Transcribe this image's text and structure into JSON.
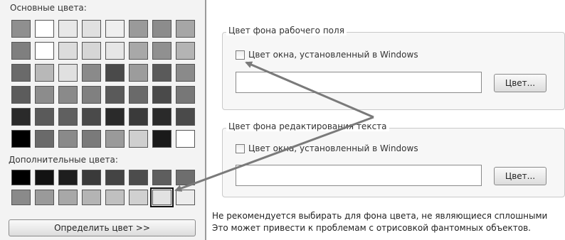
{
  "left_panel": {
    "basic_colors_label": "Основные цвета:",
    "custom_colors_label": "Дополнительные цвета:",
    "define_color_button": "Определить цвет >>",
    "basic_colors": [
      [
        "#8f8f8f",
        "#ffffff",
        "#e8e8e8",
        "#e0e0e0",
        "#efefef",
        "#9a9a9a",
        "#8c8c8c",
        "#a6a6a6"
      ],
      [
        "#7f7f7f",
        "#ffffff",
        "#dcdcdc",
        "#d6d6d6",
        "#e6e6e6",
        "#a8a8a8",
        "#909090",
        "#b4b4b4"
      ],
      [
        "#6a6a6a",
        "#b8b8b8",
        "#e0e0e0",
        "#8a8a8a",
        "#4a4a4a",
        "#9c9c9c",
        "#5a5a5a",
        "#8a8a8a"
      ],
      [
        "#5c5c5c",
        "#8c8c8c",
        "#8a8a8a",
        "#808080",
        "#5a5a5a",
        "#6a6a6a",
        "#4a4a4a",
        "#777777"
      ],
      [
        "#2a2a2a",
        "#5a5a5a",
        "#606060",
        "#4a4a4a",
        "#2a2a2a",
        "#3a3a3a",
        "#2a2a2a",
        "#4a4a4a"
      ],
      [
        "#000000",
        "#6a6a6a",
        "#8a8a8a",
        "#7a7a7a",
        "#9a9a9a",
        "#cfcfcf",
        "#1a1a1a",
        "#ffffff"
      ]
    ],
    "custom_colors": [
      [
        "#000000",
        "#121212",
        "#1e1e1e",
        "#3a3a3a",
        "#444444",
        "#4c4c4c",
        "#5e5e5e",
        "#6e6e6e"
      ],
      [
        "#8a8a8a",
        "#9a9a9a",
        "#a8a8a8",
        "#b4b4b4",
        "#c0c0c0",
        "#d0d0d0",
        "#e2e2e2",
        "#ececec"
      ]
    ],
    "selected_custom": [
      1,
      6
    ]
  },
  "right_panel": {
    "workspace_group_title": "Цвет фона рабочего поля",
    "workspace_checkbox_label": "Цвет окна, установленный в Windows",
    "workspace_color_button": "Цвет...",
    "workspace_field_value": "",
    "text_group_title": "Цвет фона редактирования текста",
    "text_checkbox_label": "Цвет окна, установленный в Windows",
    "text_color_button": "Цвет...",
    "text_field_value": "",
    "note_line1": "Не рекомендуется выбирать для фона цвета, не являющиеся сплошными",
    "note_line2": "Это может привести к проблемам с отрисовкой фантомных объектов."
  },
  "annotation": {
    "arrow_color": "#7a7a7a"
  }
}
